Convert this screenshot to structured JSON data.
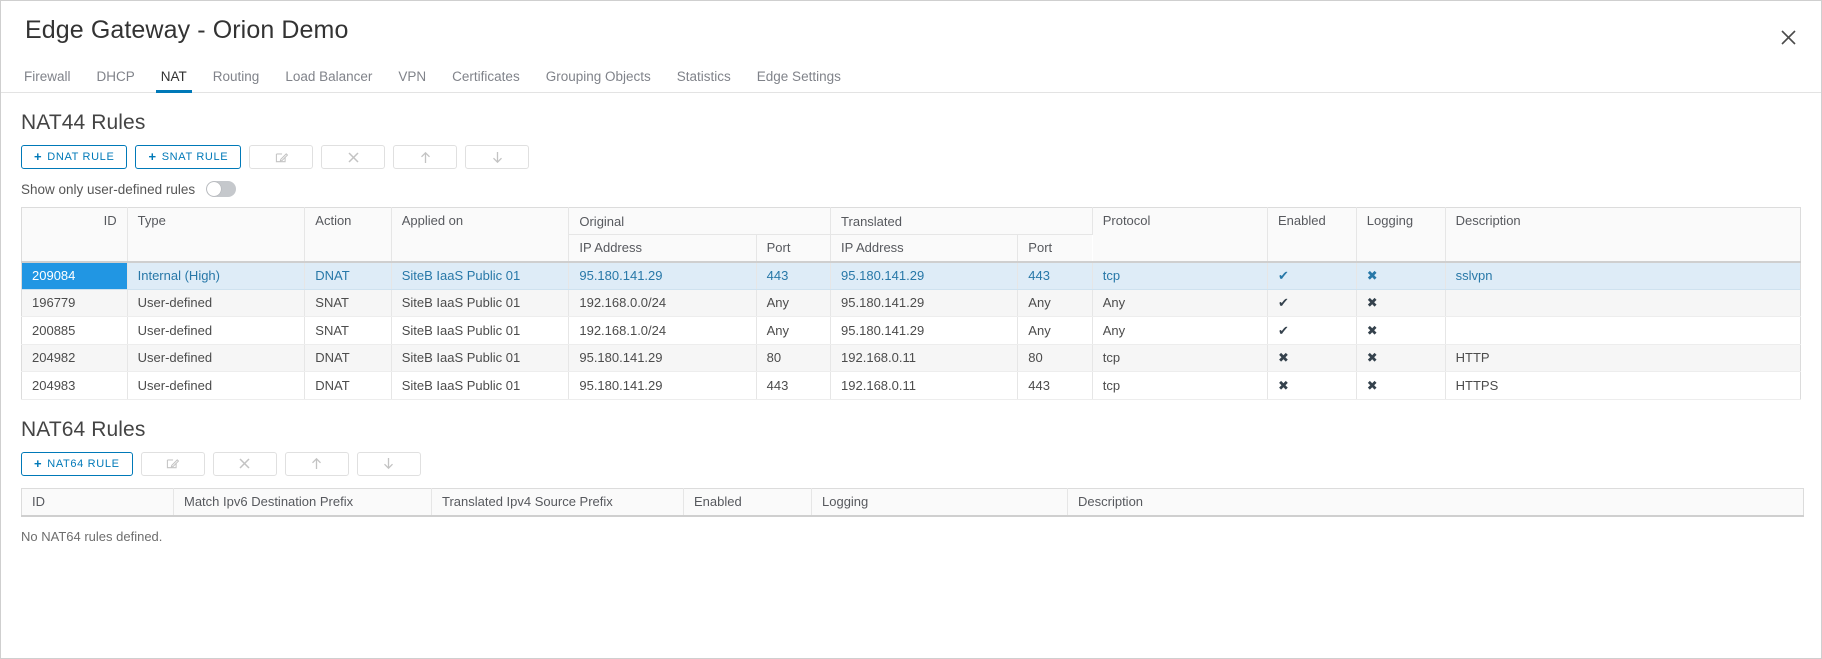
{
  "window": {
    "title": "Edge Gateway - Orion Demo",
    "close_icon": "close-icon"
  },
  "tabs": [
    {
      "label": "Firewall",
      "active": false
    },
    {
      "label": "DHCP",
      "active": false
    },
    {
      "label": "NAT",
      "active": true
    },
    {
      "label": "Routing",
      "active": false
    },
    {
      "label": "Load Balancer",
      "active": false
    },
    {
      "label": "VPN",
      "active": false
    },
    {
      "label": "Certificates",
      "active": false
    },
    {
      "label": "Grouping Objects",
      "active": false
    },
    {
      "label": "Statistics",
      "active": false
    },
    {
      "label": "Edge Settings",
      "active": false
    }
  ],
  "nat44": {
    "section_title": "NAT44 Rules",
    "buttons": {
      "dnat": "DNAT RULE",
      "snat": "SNAT RULE",
      "plus": "+",
      "edit_icon": "edit-icon",
      "delete_icon": "close-x-icon",
      "move_up_icon": "arrow-up-icon",
      "move_down_icon": "arrow-down-icon"
    },
    "toggle": {
      "label": "Show only user-defined rules",
      "on": false
    },
    "headers": {
      "id": "ID",
      "type": "Type",
      "action": "Action",
      "applied_on": "Applied on",
      "original": "Original",
      "translated": "Translated",
      "protocol": "Protocol",
      "enabled": "Enabled",
      "logging": "Logging",
      "description": "Description",
      "ip_address": "IP Address",
      "port": "Port"
    },
    "rows": [
      {
        "id": "209084",
        "type": "Internal (High)",
        "action": "DNAT",
        "applied_on": "SiteB IaaS Public 01",
        "orig_ip": "95.180.141.29",
        "orig_port": "443",
        "trans_ip": "95.180.141.29",
        "trans_port": "443",
        "protocol": "tcp",
        "enabled": "✔",
        "logging": "✖",
        "description": "sslvpn",
        "selected": true
      },
      {
        "id": "196779",
        "type": "User-defined",
        "action": "SNAT",
        "applied_on": "SiteB IaaS Public 01",
        "orig_ip": "192.168.0.0/24",
        "orig_port": "Any",
        "trans_ip": "95.180.141.29",
        "trans_port": "Any",
        "protocol": "Any",
        "enabled": "✔",
        "logging": "✖",
        "description": "",
        "selected": false
      },
      {
        "id": "200885",
        "type": "User-defined",
        "action": "SNAT",
        "applied_on": "SiteB IaaS Public 01",
        "orig_ip": "192.168.1.0/24",
        "orig_port": "Any",
        "trans_ip": "95.180.141.29",
        "trans_port": "Any",
        "protocol": "Any",
        "enabled": "✔",
        "logging": "✖",
        "description": "",
        "selected": false
      },
      {
        "id": "204982",
        "type": "User-defined",
        "action": "DNAT",
        "applied_on": "SiteB IaaS Public 01",
        "orig_ip": "95.180.141.29",
        "orig_port": "80",
        "trans_ip": "192.168.0.11",
        "trans_port": "80",
        "protocol": "tcp",
        "enabled": "✖",
        "logging": "✖",
        "description": "HTTP",
        "selected": false
      },
      {
        "id": "204983",
        "type": "User-defined",
        "action": "DNAT",
        "applied_on": "SiteB IaaS Public 01",
        "orig_ip": "95.180.141.29",
        "orig_port": "443",
        "trans_ip": "192.168.0.11",
        "trans_port": "443",
        "protocol": "tcp",
        "enabled": "✖",
        "logging": "✖",
        "description": "HTTPS",
        "selected": false
      }
    ]
  },
  "nat64": {
    "section_title": "NAT64 Rules",
    "buttons": {
      "add": "NAT64 RULE",
      "plus": "+",
      "edit_icon": "edit-icon",
      "delete_icon": "close-x-icon",
      "move_up_icon": "arrow-up-icon",
      "move_down_icon": "arrow-down-icon"
    },
    "headers": {
      "id": "ID",
      "match_prefix": "Match Ipv6 Destination Prefix",
      "translated_prefix": "Translated Ipv4 Source Prefix",
      "enabled": "Enabled",
      "logging": "Logging",
      "description": "Description"
    },
    "empty_message": "No NAT64 rules defined."
  },
  "colors": {
    "accent": "#0079b8",
    "selected_row_bg": "#deecf7",
    "selected_id_bg": "#2196e3",
    "alt_row_bg": "#f6f6f6"
  }
}
